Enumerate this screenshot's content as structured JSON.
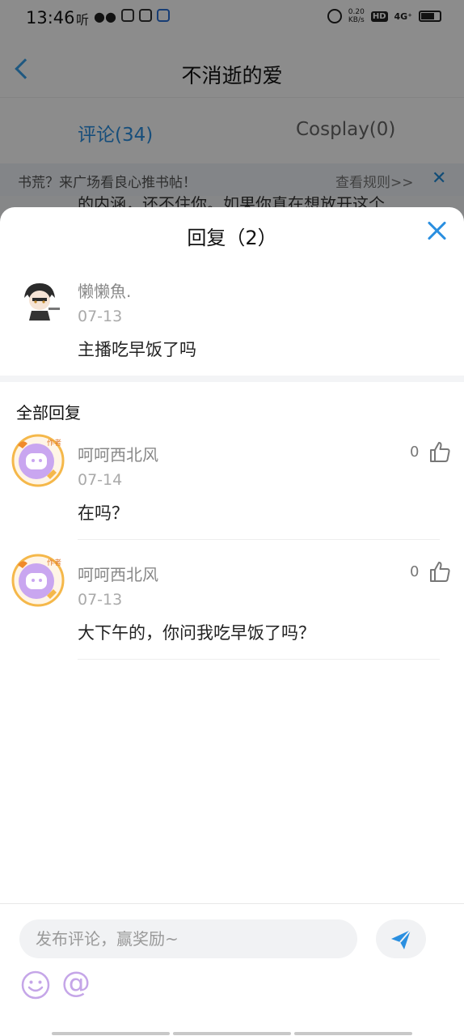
{
  "status_bar": {
    "time": "13:46",
    "left_icons": [
      "听"
    ],
    "net_speed_value": "0.20",
    "net_speed_unit": "KB/s",
    "hd": "HD",
    "signal": "4G⁺"
  },
  "background_page": {
    "title": "不消逝的爱",
    "tabs": [
      {
        "label": "评论(34)",
        "active": true
      },
      {
        "label": "Cosplay(0)",
        "active": false
      }
    ],
    "notice_text": "书荒？来广场看良心推书帖！",
    "notice_link": "查看规则>>",
    "notice_close": "✕",
    "peek_text": "的内涵，还不住你。如果你真在想放开这个"
  },
  "sheet": {
    "title": "回复（2）",
    "original_comment": {
      "user": "懒懒魚.",
      "date": "07-13",
      "text": "主播吃早饭了吗"
    },
    "section_title": "全部回复",
    "replies": [
      {
        "user": "呵呵西北风",
        "date": "07-14",
        "text": "在吗？",
        "likes": "0",
        "badge": "作者"
      },
      {
        "user": "呵呵西北风",
        "date": "07-13",
        "text": "大下午的，你问我吃早饭了吗？",
        "likes": "0",
        "badge": "作者"
      }
    ]
  },
  "input_bar": {
    "placeholder": "发布评论，赢奖励~",
    "at_symbol": "@"
  },
  "colors": {
    "accent": "#2a8fe0",
    "author_avatar": "#c9a6f0",
    "author_ring": "#f5b84a"
  }
}
